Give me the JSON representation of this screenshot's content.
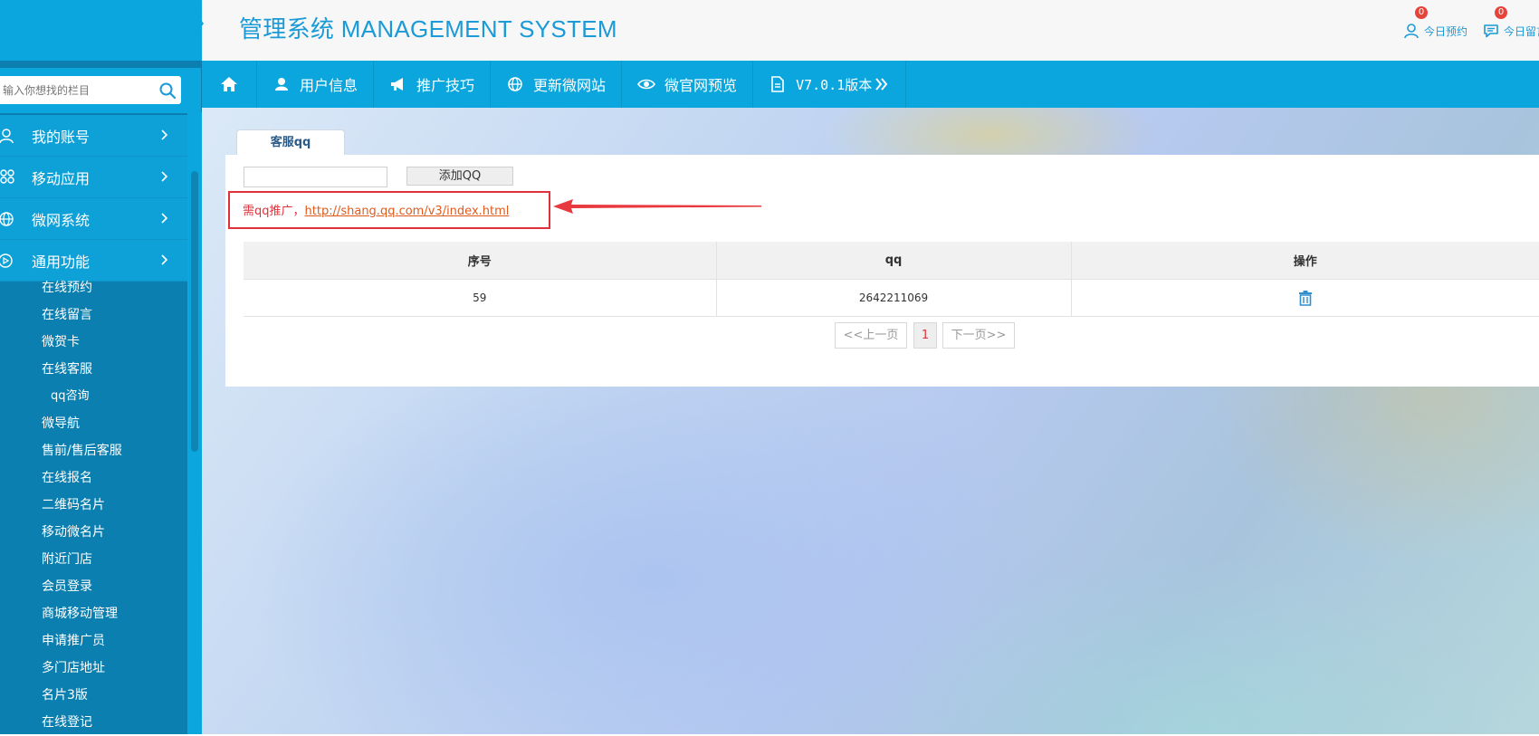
{
  "header": {
    "title": "管理系统 MANAGEMENT SYSTEM",
    "notifications": [
      {
        "label": "今日预约",
        "count": "0",
        "icon": "user-icon"
      },
      {
        "label": "今日留言",
        "count": "0",
        "icon": "message-icon"
      }
    ]
  },
  "sidebar": {
    "search_placeholder": "输入你想找的栏目",
    "groups": [
      {
        "label": "我的账号",
        "icon": "user-icon"
      },
      {
        "label": "移动应用",
        "icon": "apps-icon"
      },
      {
        "label": "微网系统",
        "icon": "globe-icon"
      },
      {
        "label": "通用功能",
        "icon": "play-circle-icon"
      }
    ],
    "items": [
      "在线预约",
      "在线留言",
      "微贺卡",
      "在线客服",
      "qq咨询",
      "微导航",
      "售前/售后客服",
      "在线报名",
      "二维码名片",
      "移动微名片",
      "附近门店",
      "会员登录",
      "商城移动管理",
      "申请推广员",
      "多门店地址",
      "名片3版",
      "在线登记"
    ]
  },
  "nav": {
    "items": [
      {
        "label": "",
        "icon": "home-icon"
      },
      {
        "label": "用户信息",
        "icon": "user-icon"
      },
      {
        "label": "推广技巧",
        "icon": "megaphone-icon"
      },
      {
        "label": "更新微网站",
        "icon": "globe-icon"
      },
      {
        "label": "微官网预览",
        "icon": "eye-icon"
      },
      {
        "label": "V7.0.1版本",
        "icon": "document-icon"
      }
    ]
  },
  "main": {
    "tab_label": "客服qq",
    "qq_input_value": "",
    "add_button": "添加QQ",
    "notice_prefix": "需qq推广，",
    "notice_link": "http://shang.qq.com/v3/index.html",
    "table": {
      "headers": [
        "序号",
        "qq",
        "操作"
      ],
      "rows": [
        {
          "id": "59",
          "qq": "2642211069",
          "action_icon": "trash-icon"
        }
      ]
    },
    "pager": {
      "prev": "<<上一页",
      "current": "1",
      "next": "下一页>>"
    }
  },
  "colors": {
    "brand": "#0aa6dd",
    "sidebar_dark": "#0a7fb0",
    "title_blue": "#1a9ad6",
    "alert_red": "#e0313a"
  }
}
